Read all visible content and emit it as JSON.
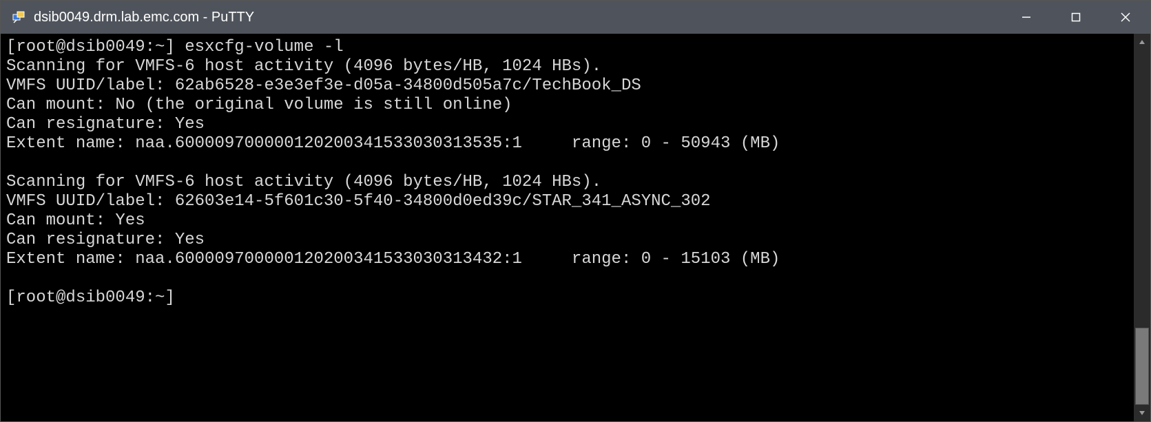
{
  "window": {
    "title": "dsib0049.drm.lab.emc.com - PuTTY"
  },
  "terminal": {
    "prompt1": "[root@dsib0049:~] ",
    "command1": "esxcfg-volume -l",
    "line_scan1": "Scanning for VMFS-6 host activity (4096 bytes/HB, 1024 HBs).",
    "line_uuid1": "VMFS UUID/label: 62ab6528-e3e3ef3e-d05a-34800d505a7c/TechBook_DS",
    "line_mount1": "Can mount: No (the original volume is still online)",
    "line_resig1": "Can resignature: Yes",
    "line_extent1": "Extent name: naa.60000970000012020034153303031353​5:1     range: 0 - 50943 (MB)",
    "line_extent1_fix": "Extent name: naa.600009700000120200341533030313535:1     range: 0 - 50943 (MB)",
    "blank": "",
    "line_scan2": "Scanning for VMFS-6 host activity (4096 bytes/HB, 1024 HBs).",
    "line_uuid2": "VMFS UUID/label: 62603e14-5f601c30-5f40-34800d0ed39c/STAR_341_ASYNC_302",
    "line_mount2": "Can mount: Yes",
    "line_resig2": "Can resignature: Yes",
    "line_extent2": "Extent name: naa.600009700000120200341533030313432:1     range: 0 - 15103 (MB)",
    "prompt2": "[root@dsib0049:~] "
  }
}
